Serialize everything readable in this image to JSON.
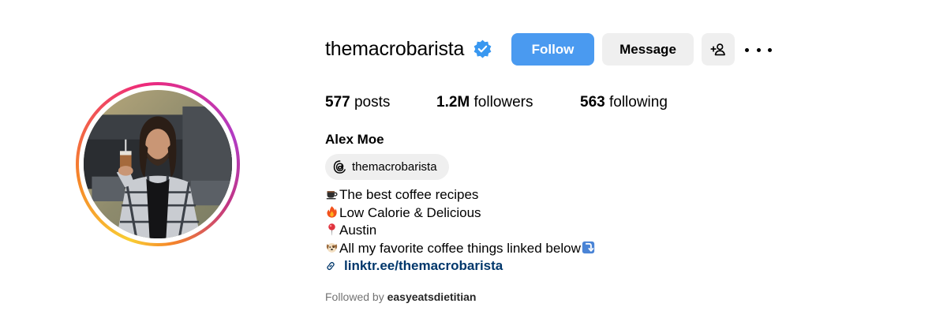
{
  "profile": {
    "username": "themacrobarista",
    "verified": true,
    "full_name": "Alex Moe",
    "threads_handle": "themacrobarista"
  },
  "actions": {
    "follow_label": "Follow",
    "message_label": "Message",
    "suggest_icon": "person-plus-icon",
    "more_icon": "more-options-icon"
  },
  "stats": {
    "posts_count": "577",
    "posts_label": "posts",
    "followers_count": "1.2M",
    "followers_label": "followers",
    "following_count": "563",
    "following_label": "following"
  },
  "bio": {
    "lines": [
      {
        "emoji": "coffee-cup-icon",
        "text": "The best coffee recipes"
      },
      {
        "emoji": "fire-icon",
        "text": "Low Calorie & Delicious"
      },
      {
        "emoji": "round-pushpin-icon",
        "text": "Austin"
      },
      {
        "emoji": "dog-face-icon",
        "text": "All my favorite coffee things linked below",
        "trailing_emoji": "arrow-down-icon"
      }
    ],
    "link": "linktr.ee/themacrobarista"
  },
  "followed_by": {
    "prefix": "Followed by",
    "user": "easyeatsdietitian"
  },
  "colors": {
    "follow_button": "#4a9af0",
    "secondary_button": "#efefef",
    "link": "#00376b",
    "muted_text": "#737373",
    "verified_badge": "#3897f0"
  }
}
